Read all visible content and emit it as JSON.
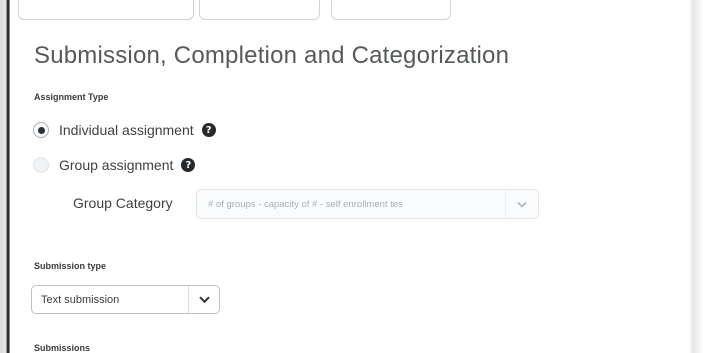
{
  "section": {
    "title": "Submission, Completion and Categorization"
  },
  "assignment_type": {
    "label": "Assignment Type",
    "options": [
      {
        "label": "Individual assignment",
        "selected": true
      },
      {
        "label": "Group assignment",
        "selected": false
      }
    ],
    "help_icon": "question-circle-icon"
  },
  "group_category": {
    "label": "Group Category",
    "value": "# of groups - capacity of # - self enrollment tes",
    "disabled": true
  },
  "submission_type": {
    "label": "Submission type",
    "value": "Text submission"
  },
  "submissions": {
    "label": "Submissions"
  },
  "colors": {
    "text": "#494c4e",
    "border": "#cdd5dc",
    "disabled_text": "#a9afb4"
  }
}
